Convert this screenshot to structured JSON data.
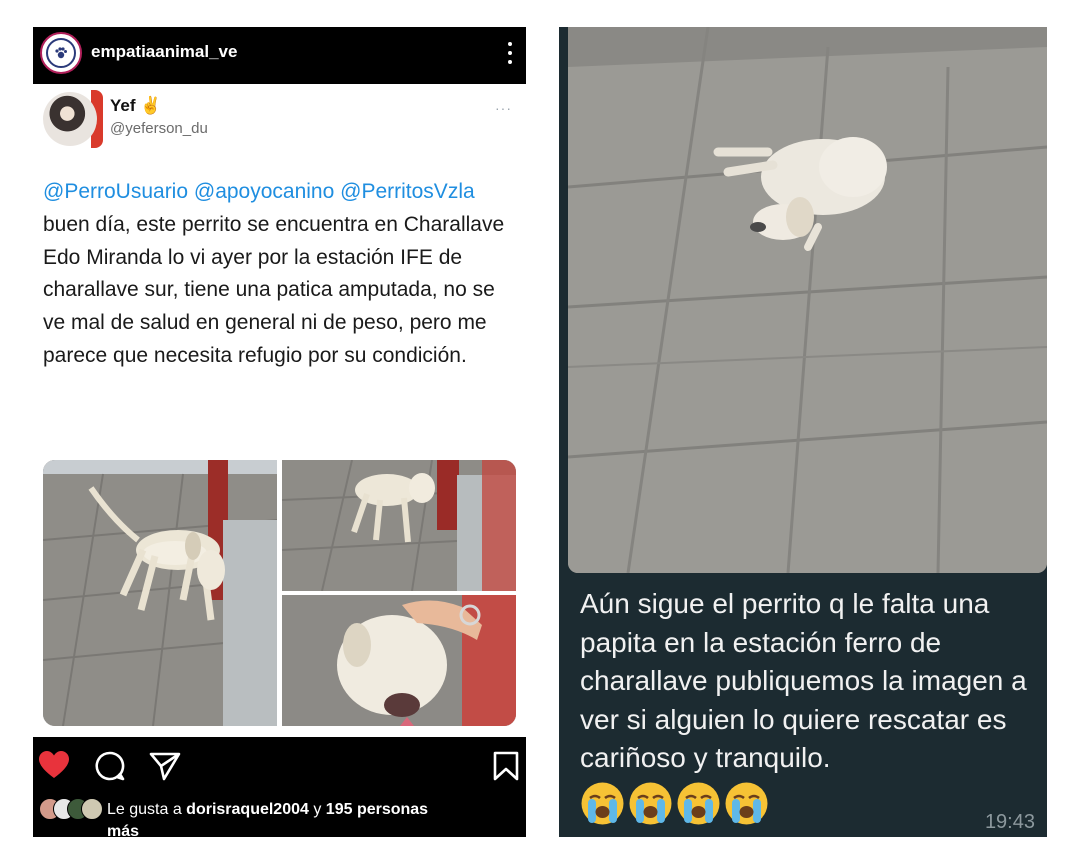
{
  "instagram": {
    "username": "empatiaanimal_ve",
    "tweet": {
      "name": "Yef",
      "name_emoji": "✌",
      "handle": "@yeferson_du",
      "more": "···",
      "mention_1": "@PerroUsuario",
      "mention_2": "@apoyocanino",
      "mention_3": "@PerritosVzla",
      "body": " buen día, este perrito se encuentra en Charallave Edo Miranda lo vi ayer por la estación IFE de charallave sur, tiene una patica amputada, no se ve mal de salud en general ni de peso, pero me parece que necesita refugio por su condición."
    },
    "likes": {
      "prefix": "Le gusta a ",
      "user": "dorisraquel2004",
      "joiner": " y ",
      "count_text": "195 personas",
      "suffix": "más"
    },
    "icons": [
      "heart-icon",
      "comment-icon",
      "share-icon",
      "bookmark-icon"
    ],
    "colors": {
      "heart": "#e8333c",
      "mention": "#1f8ee0"
    }
  },
  "chat": {
    "message": "Aún sigue el perrito q le falta una papita en la estación ferro de charallave publiquemos la imagen a ver si alguien lo quiere rescatar es cariñoso y tranquilo.",
    "emojis": [
      "loudly-crying-face",
      "loudly-crying-face",
      "loudly-crying-face",
      "loudly-crying-face"
    ],
    "time": "19:43",
    "colors": {
      "background": "#1c2b31"
    }
  }
}
